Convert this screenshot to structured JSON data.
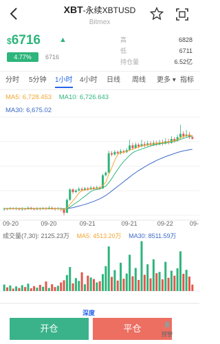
{
  "header": {
    "title": "XBT",
    "subtitle": "-永续XBTUSD",
    "exchange": "Bitmex"
  },
  "quote": {
    "currency_symbol": "$",
    "price": "6716",
    "change_pct": "4.77%",
    "price_secondary": "6716"
  },
  "stats": [
    {
      "label": "高",
      "value": "6828"
    },
    {
      "label": "低",
      "value": "6711"
    },
    {
      "label": "持仓量",
      "value": "6.52亿"
    }
  ],
  "tabs": [
    {
      "label": "分时"
    },
    {
      "label": "5分钟"
    },
    {
      "label": "1小时"
    },
    {
      "label": "4小时"
    },
    {
      "label": "日线"
    },
    {
      "label": "周线"
    },
    {
      "label": "更多 ▾"
    },
    {
      "label": "指标"
    }
  ],
  "active_tab": "1小时",
  "ma_legend": {
    "ma5": "MA5: 6,728.453",
    "ma10": "MA10: 6,726.643",
    "ma30": "MA30: 6,675.02"
  },
  "volume_legend": {
    "vol": "成交量(7,30): 2125.23万",
    "ma5": "MA5: 4513.20万",
    "ma30": "MA30: 8511.59万"
  },
  "x_ticks": [
    "09-20",
    "09-20",
    "09-21",
    "09-21",
    "09-22",
    "09-"
  ],
  "market_link": "深度",
  "buttons": {
    "open": "开仓",
    "close": "平仓",
    "alert": "预警"
  },
  "colors": {
    "up": "#2eb57c",
    "down": "#e0594d",
    "ma5": "#f2a531",
    "ma10": "#2eb57c",
    "ma30": "#3a68c8",
    "accent": "#2563eb"
  },
  "chart_data": {
    "type": "candlestick",
    "price_range": [
      6420,
      6800
    ],
    "x_tick_labels": [
      "09-20",
      "09-20",
      "09-21",
      "09-21",
      "09-22",
      "09-"
    ],
    "candles": [
      [
        6443,
        6446,
        6438,
        6450
      ],
      [
        6446,
        6444,
        6440,
        6449
      ],
      [
        6444,
        6448,
        6441,
        6452
      ],
      [
        6448,
        6445,
        6442,
        6451
      ],
      [
        6445,
        6447,
        6440,
        6452
      ],
      [
        6447,
        6443,
        6439,
        6450
      ],
      [
        6443,
        6446,
        6437,
        6452
      ],
      [
        6446,
        6444,
        6440,
        6449
      ],
      [
        6444,
        6449,
        6441,
        6455
      ],
      [
        6449,
        6446,
        6441,
        6453
      ],
      [
        6446,
        6443,
        6439,
        6450
      ],
      [
        6443,
        6447,
        6440,
        6452
      ],
      [
        6447,
        6444,
        6439,
        6451
      ],
      [
        6444,
        6448,
        6441,
        6453
      ],
      [
        6448,
        6445,
        6440,
        6452
      ],
      [
        6445,
        6449,
        6442,
        6456
      ],
      [
        6449,
        6446,
        6441,
        6454
      ],
      [
        6446,
        6444,
        6438,
        6451
      ],
      [
        6444,
        6447,
        6440,
        6452
      ],
      [
        6447,
        6443,
        6436,
        6450
      ],
      [
        6443,
        6430,
        6420,
        6446
      ],
      [
        6430,
        6480,
        6428,
        6485
      ],
      [
        6480,
        6520,
        6476,
        6525
      ],
      [
        6520,
        6510,
        6503,
        6524
      ],
      [
        6510,
        6516,
        6506,
        6522
      ],
      [
        6516,
        6522,
        6512,
        6530
      ],
      [
        6522,
        6518,
        6512,
        6528
      ],
      [
        6518,
        6524,
        6514,
        6530
      ],
      [
        6524,
        6520,
        6515,
        6530
      ],
      [
        6520,
        6527,
        6518,
        6534
      ],
      [
        6527,
        6523,
        6518,
        6532
      ],
      [
        6523,
        6528,
        6520,
        6535
      ],
      [
        6528,
        6524,
        6519,
        6532
      ],
      [
        6524,
        6575,
        6522,
        6580
      ],
      [
        6575,
        6585,
        6570,
        6590
      ],
      [
        6585,
        6660,
        6582,
        6670
      ],
      [
        6660,
        6655,
        6648,
        6668
      ],
      [
        6655,
        6665,
        6650,
        6672
      ],
      [
        6665,
        6660,
        6652,
        6670
      ],
      [
        6660,
        6668,
        6655,
        6676
      ],
      [
        6668,
        6664,
        6658,
        6674
      ],
      [
        6664,
        6672,
        6660,
        6680
      ],
      [
        6672,
        6690,
        6668,
        6712
      ],
      [
        6690,
        6680,
        6672,
        6700
      ],
      [
        6680,
        6693,
        6676,
        6702
      ],
      [
        6693,
        6686,
        6679,
        6700
      ],
      [
        6686,
        6695,
        6682,
        6712
      ],
      [
        6695,
        6690,
        6683,
        6704
      ],
      [
        6690,
        6698,
        6686,
        6708
      ],
      [
        6698,
        6692,
        6686,
        6706
      ],
      [
        6692,
        6700,
        6688,
        6710
      ],
      [
        6700,
        6694,
        6688,
        6708
      ],
      [
        6694,
        6702,
        6690,
        6712
      ],
      [
        6702,
        6697,
        6690,
        6712
      ],
      [
        6697,
        6706,
        6693,
        6718
      ],
      [
        6706,
        6700,
        6694,
        6716
      ],
      [
        6700,
        6715,
        6696,
        6726
      ],
      [
        6715,
        6708,
        6700,
        6722
      ],
      [
        6708,
        6722,
        6704,
        6732
      ],
      [
        6722,
        6735,
        6715,
        6770
      ],
      [
        6735,
        6726,
        6716,
        6745
      ],
      [
        6726,
        6732,
        6720,
        6750
      ],
      [
        6732,
        6722,
        6715,
        6742
      ],
      [
        6722,
        6716,
        6712,
        6728
      ]
    ],
    "ma5": [
      6446,
      6446,
      6446,
      6446,
      6446,
      6446,
      6446,
      6446,
      6446,
      6446,
      6446,
      6446,
      6446,
      6446,
      6446,
      6446,
      6446,
      6446,
      6446,
      6445,
      6442,
      6448,
      6462,
      6476,
      6490,
      6506,
      6517,
      6518,
      6520,
      6522,
      6523,
      6524,
      6525,
      6535,
      6548,
      6578,
      6604,
      6632,
      6655,
      6662,
      6664,
      6666,
      6672,
      6676,
      6680,
      6684,
      6688,
      6690,
      6692,
      6694,
      6696,
      6698,
      6700,
      6701,
      6702,
      6704,
      6706,
      6708,
      6712,
      6720,
      6724,
      6728,
      6729,
      6728
    ],
    "ma10": [
      6446,
      6446,
      6446,
      6446,
      6446,
      6446,
      6446,
      6446,
      6446,
      6446,
      6446,
      6446,
      6446,
      6446,
      6446,
      6446,
      6446,
      6446,
      6446,
      6446,
      6445,
      6446,
      6452,
      6460,
      6468,
      6476,
      6485,
      6494,
      6503,
      6512,
      6518,
      6520,
      6522,
      6527,
      6533,
      6546,
      6562,
      6580,
      6597,
      6614,
      6628,
      6640,
      6652,
      6662,
      6668,
      6672,
      6676,
      6680,
      6684,
      6688,
      6691,
      6694,
      6696,
      6698,
      6700,
      6702,
      6704,
      6706,
      6709,
      6713,
      6717,
      6721,
      6724,
      6726
    ],
    "ma30": [
      6446,
      6446,
      6446,
      6446,
      6446,
      6446,
      6446,
      6446,
      6446,
      6446,
      6446,
      6446,
      6446,
      6446,
      6446,
      6446,
      6446,
      6446,
      6446,
      6446,
      6446,
      6446,
      6448,
      6450,
      6453,
      6456,
      6459,
      6462,
      6466,
      6470,
      6474,
      6479,
      6484,
      6490,
      6497,
      6505,
      6514,
      6523,
      6532,
      6541,
      6550,
      6559,
      6568,
      6577,
      6585,
      6593,
      6600,
      6607,
      6614,
      6620,
      6626,
      6632,
      6637,
      6642,
      6647,
      6651,
      6655,
      6659,
      6663,
      6666,
      6669,
      6671,
      6673,
      6675
    ],
    "volume": [
      2.1,
      1.2,
      1.8,
      0.8,
      1.5,
      1.0,
      1.9,
      1.3,
      2.4,
      0.9,
      1.6,
      1.1,
      2.0,
      1.4,
      3.1,
      1.0,
      2.2,
      1.3,
      1.7,
      2.8,
      3.5,
      5.2,
      7.8,
      2.5,
      4.2,
      3.3,
      6.1,
      2.2,
      5.0,
      4.4,
      3.9,
      2.8,
      3.2,
      5.5,
      8.1,
      14.5,
      4.6,
      6.8,
      3.4,
      9.2,
      4.0,
      5.7,
      11.8,
      4.8,
      7.5,
      3.6,
      16.2,
      5.3,
      8.7,
      4.1,
      10.3,
      5.8,
      6.2,
      3.8,
      9.5,
      4.3,
      6.6,
      5.0,
      7.4,
      12.9,
      5.6,
      6.9,
      4.7,
      2.1
    ],
    "volume_range": [
      0,
      17
    ]
  }
}
